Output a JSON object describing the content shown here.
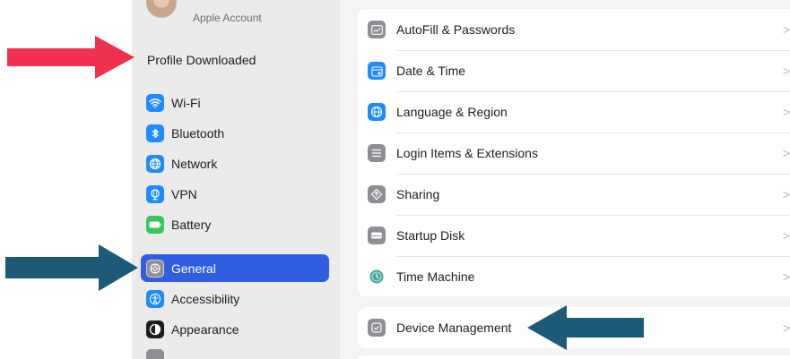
{
  "sidebar": {
    "account_label": "Apple Account",
    "profile_downloaded": "Profile Downloaded",
    "items": [
      {
        "label": "Wi-Fi",
        "icon": "wifi-icon",
        "color": "#1f8bff"
      },
      {
        "label": "Bluetooth",
        "icon": "bluetooth-icon",
        "color": "#1f8bff"
      },
      {
        "label": "Network",
        "icon": "globe-icon",
        "color": "#1f8bff"
      },
      {
        "label": "VPN",
        "icon": "vpn-icon",
        "color": "#1f8bff"
      },
      {
        "label": "Battery",
        "icon": "battery-icon",
        "color": "#34c759"
      },
      {
        "label": "General",
        "icon": "gear-icon",
        "color": "#8e8e93"
      },
      {
        "label": "Accessibility",
        "icon": "accessibility-icon",
        "color": "#1f8bff"
      },
      {
        "label": "Appearance",
        "icon": "appearance-icon",
        "color": "#1d1d1f"
      }
    ],
    "selected": "General"
  },
  "main": {
    "general_rows": [
      {
        "label": "AutoFill & Passwords",
        "icon": "autofill-icon",
        "color": "#8e8e93"
      },
      {
        "label": "Date & Time",
        "icon": "calendar-icon",
        "color": "#1f8bff"
      },
      {
        "label": "Language & Region",
        "icon": "globe-icon",
        "color": "#1f8bff"
      },
      {
        "label": "Login Items & Extensions",
        "icon": "list-icon",
        "color": "#8e8e93"
      },
      {
        "label": "Sharing",
        "icon": "sharing-icon",
        "color": "#8e8e93"
      },
      {
        "label": "Startup Disk",
        "icon": "disk-icon",
        "color": "#8e8e93"
      },
      {
        "label": "Time Machine",
        "icon": "time-machine-icon",
        "color": "#3fa79c"
      }
    ],
    "device_management": {
      "label": "Device Management",
      "icon": "device-management-icon",
      "color": "#8e8e93"
    },
    "chevron": ">"
  },
  "annotations": {
    "red_arrow_color": "#f0304f",
    "blue_arrow_color": "#1c5a78"
  }
}
